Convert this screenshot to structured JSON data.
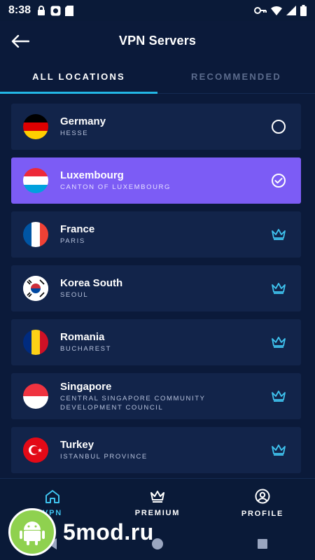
{
  "status_bar": {
    "time": "8:38",
    "icons": [
      "lock-icon",
      "app-icon",
      "sd-card-icon",
      "key-icon",
      "wifi-icon",
      "signal-icon",
      "battery-icon"
    ]
  },
  "header": {
    "title": "VPN Servers",
    "back_icon": "arrow-left-icon"
  },
  "tabs": [
    {
      "label": "ALL LOCATIONS",
      "active": true
    },
    {
      "label": "RECOMMENDED",
      "active": false
    }
  ],
  "servers": [
    {
      "country": "Germany",
      "region": "HESSE",
      "flag": "germany",
      "status": "available",
      "selected": false
    },
    {
      "country": "Luxembourg",
      "region": "CANTON OF LUXEMBOURG",
      "flag": "luxembourg",
      "status": "selected",
      "selected": true
    },
    {
      "country": "France",
      "region": "PARIS",
      "flag": "france",
      "status": "premium",
      "selected": false
    },
    {
      "country": "Korea South",
      "region": "SEOUL",
      "flag": "korea",
      "status": "premium",
      "selected": false
    },
    {
      "country": "Romania",
      "region": "BUCHAREST",
      "flag": "romania",
      "status": "premium",
      "selected": false
    },
    {
      "country": "Singapore",
      "region": "CENTRAL SINGAPORE COMMUNITY DEVELOPMENT COUNCIL",
      "flag": "singapore",
      "status": "premium",
      "selected": false
    },
    {
      "country": "Turkey",
      "region": "ISTANBUL PROVINCE",
      "flag": "turkey",
      "status": "premium",
      "selected": false
    }
  ],
  "bottom_nav": [
    {
      "label": "VPN",
      "icon": "home-icon",
      "active": true
    },
    {
      "label": "PREMIUM",
      "icon": "crown-icon",
      "active": false
    },
    {
      "label": "PROFILE",
      "icon": "profile-icon",
      "active": false
    }
  ],
  "watermark": {
    "text": "5mod.ru"
  },
  "colors": {
    "background": "#0b1a3a",
    "card": "#12244a",
    "selected_card": "#7c5cf5",
    "accent": "#23b7e5",
    "muted_text": "#5b6b8c"
  }
}
